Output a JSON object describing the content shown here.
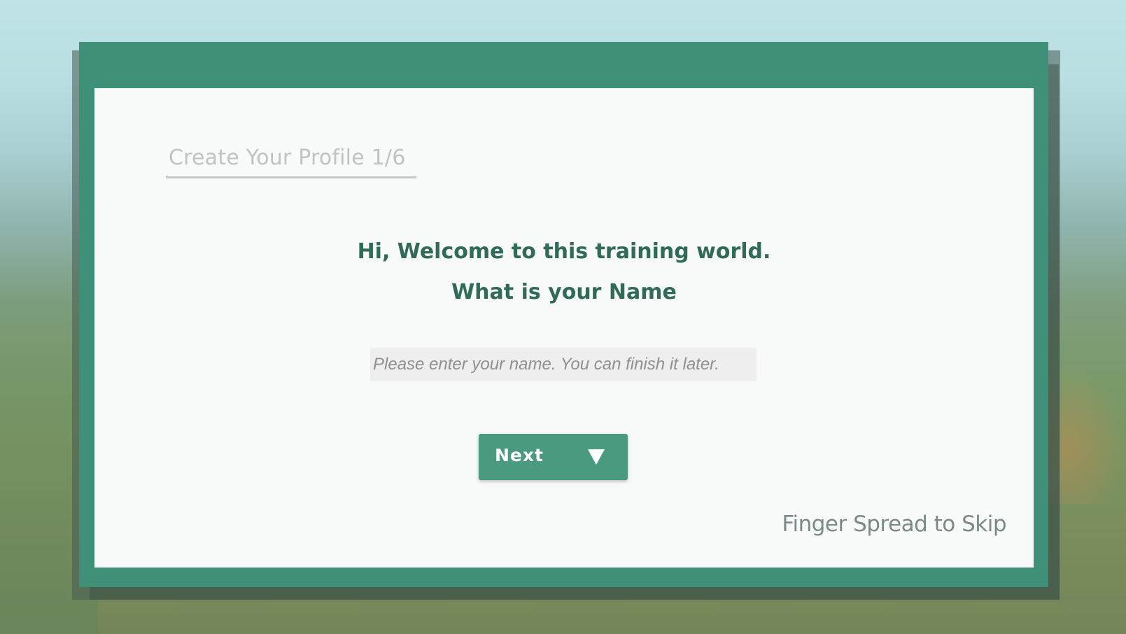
{
  "profile": {
    "step_title": "Create Your Profile 1/6"
  },
  "welcome": {
    "greeting": "Hi, Welcome to this training world.",
    "question": "What is your Name"
  },
  "name_field": {
    "value": "",
    "placeholder": "Please enter your name. You can finish it later."
  },
  "next_button": {
    "label": "Next",
    "icon": "triangle-down-icon"
  },
  "skip_hint": "Finger Spread to Skip",
  "colors": {
    "frame": "#3e9079",
    "panel": "#f8f9f9",
    "heading_text": "#2f6b57",
    "button": "#4a9a7f",
    "step_title": "#c2c2c2"
  }
}
